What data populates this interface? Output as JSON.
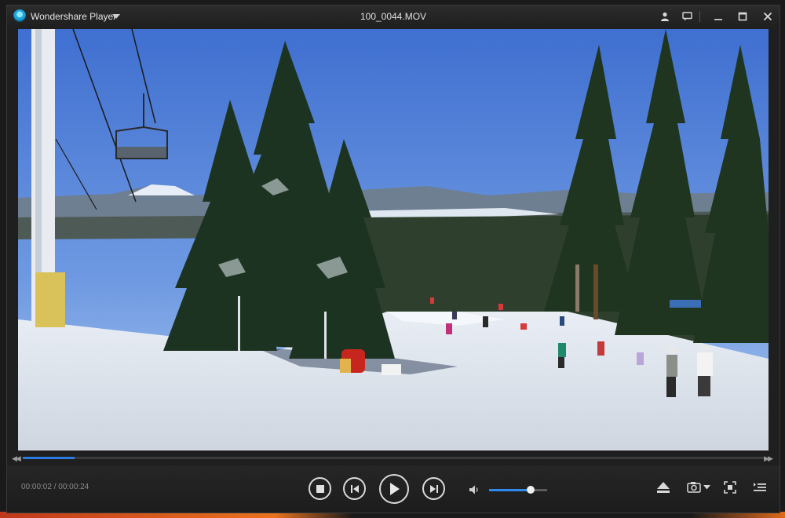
{
  "window": {
    "app_name": "Wondershare Player",
    "file_title": "100_0044.MOV"
  },
  "playback": {
    "time_display": "00:00:02 / 00:00:24",
    "progress_fraction": 0.07,
    "volume_fraction": 0.72
  },
  "colors": {
    "accent": "#2a7ae2",
    "window_bg": "#1f1f1f"
  },
  "icons": {
    "app_logo": "wondershare-logo-icon",
    "title_right": [
      "user-icon",
      "chat-icon",
      "minimize-icon",
      "maximize-icon",
      "close-icon"
    ],
    "transport": [
      "stop-icon",
      "previous-icon",
      "play-icon",
      "next-icon"
    ],
    "volume": "speaker-icon",
    "right_tools": [
      "eject-icon",
      "camera-icon",
      "fullscreen-icon",
      "playlist-icon"
    ]
  }
}
